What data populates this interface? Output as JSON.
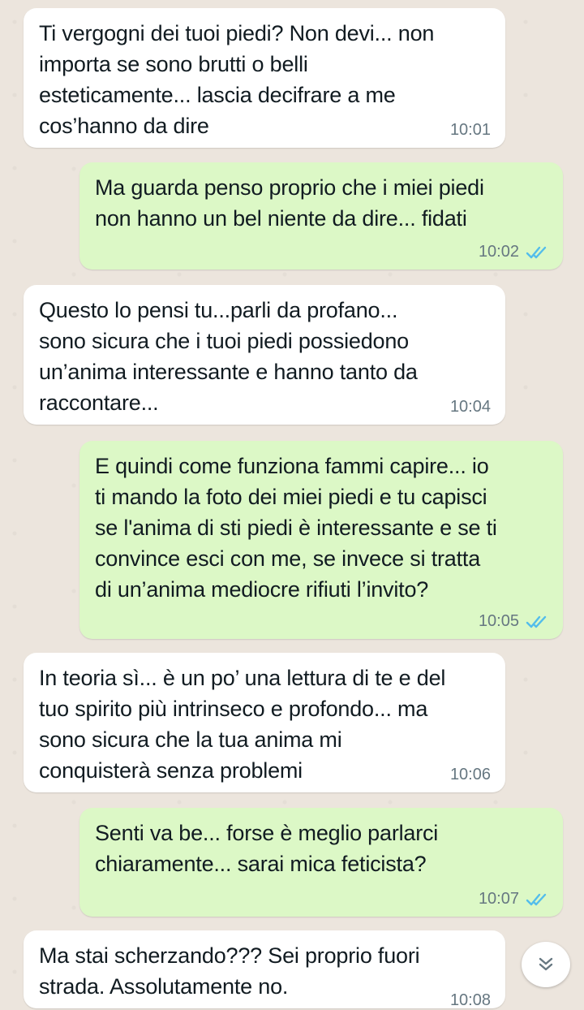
{
  "messages": [
    {
      "direction": "in",
      "text": "Ti vergogni dei tuoi piedi? Non devi... non\nimporta se sono brutti o belli\nesteticamente... lascia decifrare a me\ncos’hanno da dire",
      "time": "10:01"
    },
    {
      "direction": "out",
      "text": "Ma guarda penso proprio che i miei piedi\nnon hanno un bel niente da dire... fidati",
      "time": "10:02",
      "status": "read"
    },
    {
      "direction": "in",
      "text": "Questo lo pensi tu...parli da profano...\nsono sicura che i tuoi piedi possiedono\nun’anima interessante e hanno tanto da\nraccontare...",
      "time": "10:04"
    },
    {
      "direction": "out",
      "text": "E quindi come funziona fammi capire... io\nti mando la foto dei miei piedi e tu capisci\nse l'anima di sti piedi è interessante e se ti\nconvince esci con me, se invece si tratta\ndi un’anima mediocre rifiuti l’invito?",
      "time": "10:05",
      "status": "read"
    },
    {
      "direction": "in",
      "text": "In teoria sì... è un po’ una lettura di te e del\ntuo spirito più intrinseco e profondo... ma\nsono sicura che la tua anima mi\nconquisterà senza problemi",
      "time": "10:06"
    },
    {
      "direction": "out",
      "text": "Senti va be... forse è meglio parlarci\nchiaramente... sarai mica feticista?",
      "time": "10:07",
      "status": "read"
    },
    {
      "direction": "in",
      "text": "Ma stai scherzando??? Sei proprio fuori\nstrada. Assolutamente no.",
      "time": "10:08"
    }
  ],
  "colors": {
    "wallpaper": "#ece5dd",
    "incoming_bubble": "#ffffff",
    "outgoing_bubble": "#dcf8c6",
    "read_ticks": "#53bdeb",
    "timestamp": "#667781",
    "text": "#111b21"
  },
  "icons": {
    "read_receipt": "double-check-icon",
    "scroll_down": "double-chevron-down-icon"
  }
}
